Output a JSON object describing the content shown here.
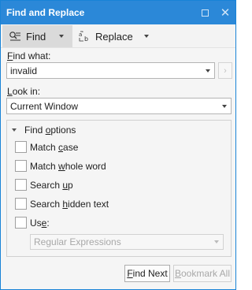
{
  "window": {
    "title": "Find and Replace"
  },
  "toolbar": {
    "find_label": "Find",
    "replace_label": "Replace"
  },
  "find": {
    "label": "Find what:",
    "value": "invalid"
  },
  "look_in": {
    "label": "Look in:",
    "value": "Current Window"
  },
  "options": {
    "header": "Find options",
    "items": [
      {
        "label": "Match case",
        "checked": false
      },
      {
        "label": "Match whole word",
        "checked": false
      },
      {
        "label": "Search up",
        "checked": false
      },
      {
        "label": "Search hidden text",
        "checked": false
      },
      {
        "label": "Use:",
        "checked": false
      }
    ],
    "use_value": "Regular Expressions"
  },
  "buttons": {
    "find_next": "Find Next",
    "bookmark_all": "Bookmark All"
  },
  "colors": {
    "title_bar": "#2b88d8",
    "border": "#1883d7",
    "active_tab": "#dadada"
  }
}
